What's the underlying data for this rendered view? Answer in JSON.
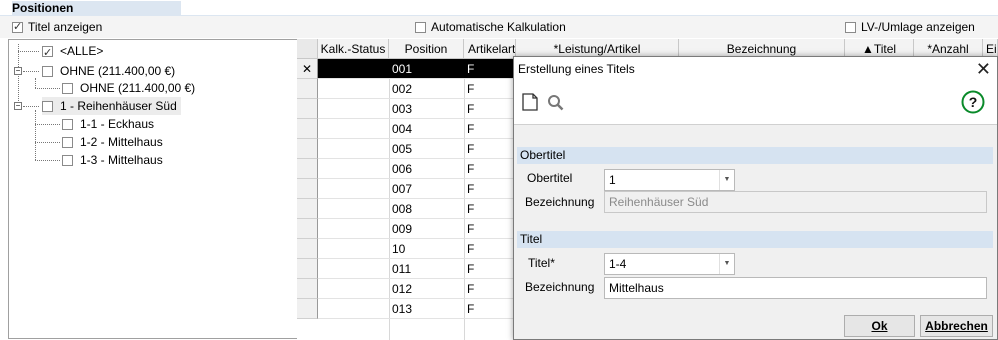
{
  "section": {
    "title": "Positionen"
  },
  "options": {
    "titel_anzeigen": {
      "label": "Titel anzeigen",
      "checked": true
    },
    "auto_kalk": {
      "label": "Automatische Kalkulation",
      "checked": false
    },
    "lv_umlage": {
      "label": "LV-/Umlage anzeigen",
      "checked": false
    }
  },
  "tree": {
    "items": [
      {
        "label": "<ALLE>",
        "checked": true
      },
      {
        "label": "OHNE (211.400,00 €)",
        "checked": false
      },
      {
        "label": "OHNE (211.400,00 €)",
        "checked": false
      },
      {
        "label": "1 - Reihenhäuser Süd",
        "checked": false
      },
      {
        "label": "1-1 - Eckhaus",
        "checked": false
      },
      {
        "label": "1-2 - Mittelhaus",
        "checked": false
      },
      {
        "label": "1-3 - Mittelhaus",
        "checked": false
      }
    ]
  },
  "grid": {
    "columns": [
      "Kalk.-Status",
      "Position",
      "Artikelart",
      "*Leistung/Artikel",
      "Bezeichnung",
      "▲Titel",
      "*Anzahl",
      "Ei"
    ],
    "rows": [
      {
        "position": "001",
        "art": "F",
        "selected": true
      },
      {
        "position": "002",
        "art": "F"
      },
      {
        "position": "003",
        "art": "F"
      },
      {
        "position": "004",
        "art": "F"
      },
      {
        "position": "005",
        "art": "F"
      },
      {
        "position": "006",
        "art": "F"
      },
      {
        "position": "007",
        "art": "F"
      },
      {
        "position": "008",
        "art": "F"
      },
      {
        "position": "009",
        "art": "F"
      },
      {
        "position": "10",
        "art": "F"
      },
      {
        "position": "011",
        "art": "F"
      },
      {
        "position": "012",
        "art": "F"
      },
      {
        "position": "013",
        "art": "F"
      }
    ]
  },
  "dialog": {
    "title": "Erstellung eines Titels",
    "obertitel_group": "Obertitel",
    "obertitel_label": "Obertitel",
    "obertitel_value": "1",
    "ober_bez_label": "Bezeichnung",
    "ober_bez_value": "Reihenhäuser Süd",
    "titel_group": "Titel",
    "titel_label": "Titel*",
    "titel_value": "1-4",
    "titel_bez_label": "Bezeichnung",
    "titel_bez_value": "Mittelhaus",
    "ok_label": "Ok",
    "cancel_label": "Abbrechen"
  },
  "colors": {
    "header_blue": "#dce6f1",
    "group_blue": "#d6e3f1",
    "selected_row": "#000000",
    "help_green": "#0a8a2a"
  },
  "icons": [
    "new-document-icon",
    "search-icon",
    "help-icon",
    "close-icon"
  ]
}
